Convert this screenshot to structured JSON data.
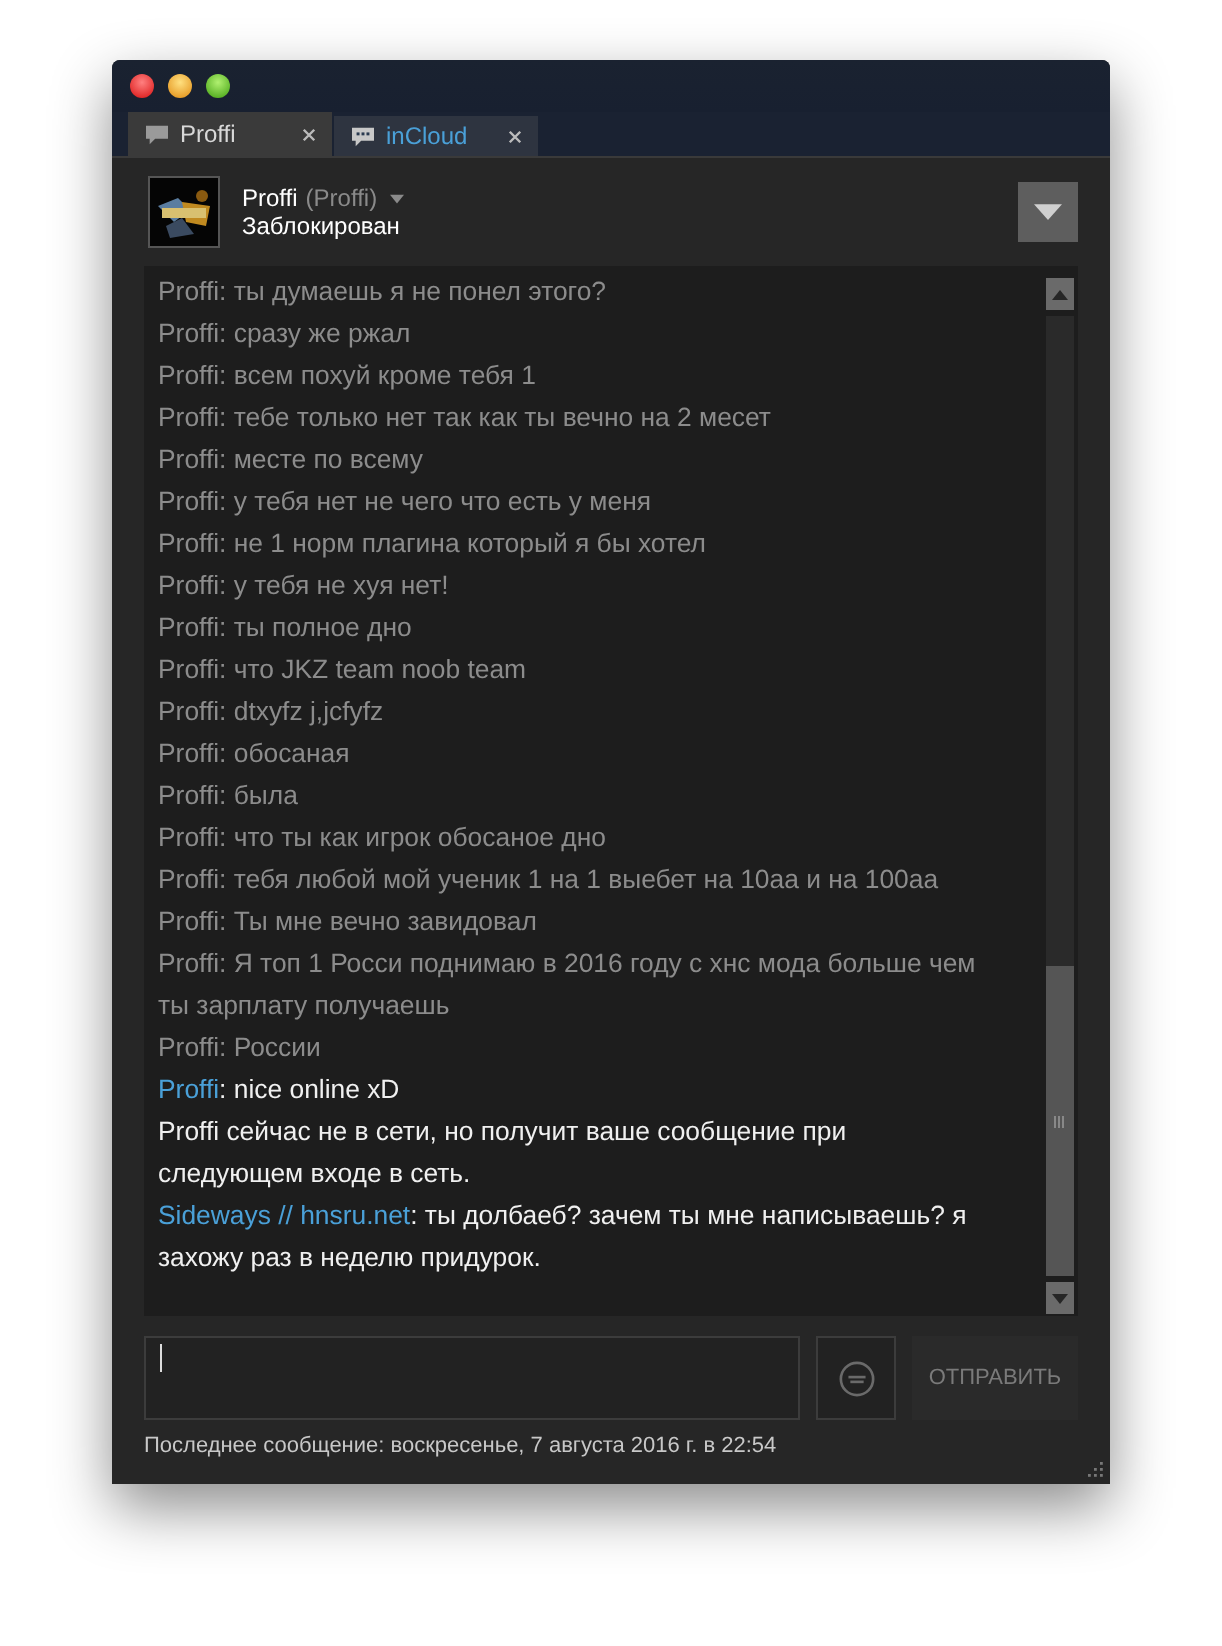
{
  "tabs": [
    {
      "label": "Proffi",
      "selected": true
    },
    {
      "label": "inCloud",
      "selected": false
    }
  ],
  "friend": {
    "name": "Proffi",
    "nickname": "(Proffi)",
    "status": "Заблокирован"
  },
  "messages": [
    {
      "kind": "history",
      "text": "Proffi: ты думаешь я не понел этого?"
    },
    {
      "kind": "history",
      "text": "Proffi: сразу же ржал"
    },
    {
      "kind": "history",
      "text": "Proffi: всем похуй кроме тебя 1"
    },
    {
      "kind": "history",
      "text": "Proffi: тебе только нет так как ты вечно на 2 месет"
    },
    {
      "kind": "history",
      "text": "Proffi: месте по всему"
    },
    {
      "kind": "history",
      "text": "Proffi: у тебя нет не чего что есть у меня"
    },
    {
      "kind": "history",
      "text": "Proffi: не 1 норм плагина который я бы хотел"
    },
    {
      "kind": "history",
      "text": "Proffi: у тебя не хуя нет!"
    },
    {
      "kind": "history",
      "text": "Proffi: ты полное дно"
    },
    {
      "kind": "history",
      "text": "Proffi: что JKZ team noob team"
    },
    {
      "kind": "history",
      "text": "Proffi: dtxyfz j,jcfyfz"
    },
    {
      "kind": "history",
      "text": "Proffi: обосаная"
    },
    {
      "kind": "history",
      "text": "Proffi: была"
    },
    {
      "kind": "history",
      "text": "Proffi: что ты как игрок обосаное дно"
    },
    {
      "kind": "history",
      "text": "Proffi: тебя любой мой ученик 1 на 1 выебет на 10аа и на 100аа"
    },
    {
      "kind": "history",
      "text": "Proffi: Ты мне вечно завидовал"
    },
    {
      "kind": "history",
      "text": "Proffi: Я топ 1 Росси поднимаю в 2016 году с хнс мода больше чем ты зарплату получаешь"
    },
    {
      "kind": "history",
      "text": "Proffi: России"
    },
    {
      "kind": "message",
      "sender": "Proffi",
      "text": ": nice online xD"
    },
    {
      "kind": "notice",
      "text": "Proffi сейчас не в сети, но получит ваше сообщение при следующем входе в сеть."
    },
    {
      "kind": "message",
      "sender": "Sideways // hnsru.net",
      "text": ": ты долбаеб? зачем ты мне написываешь? я захожу раз в неделю придурок."
    }
  ],
  "send_button": "ОТПРАВИТЬ",
  "status_bar": "Последнее сообщение: воскресенье, 7 августа 2016 г. в 22:54"
}
